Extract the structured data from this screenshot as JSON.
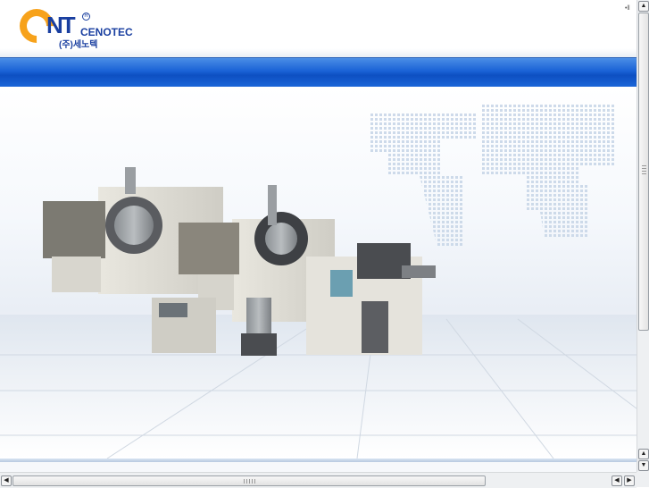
{
  "header": {
    "logo_letters": "NT",
    "logo_registered": "R",
    "brand_name": "CENOTEC",
    "brand_korean": "(주)세노텍",
    "corner_mark": "•ll"
  },
  "colors": {
    "logo_orange": "#f7a21b",
    "logo_blue": "#1a3fa0",
    "nav_blue": "#1a62d6"
  },
  "hero": {
    "image_description_icon": "bead-mill-machines-image"
  },
  "scrollbars": {
    "vertical_up_icon": "▲",
    "vertical_down_icon": "▼",
    "horizontal_left_icon": "◀",
    "horizontal_right_icon": "▶"
  }
}
